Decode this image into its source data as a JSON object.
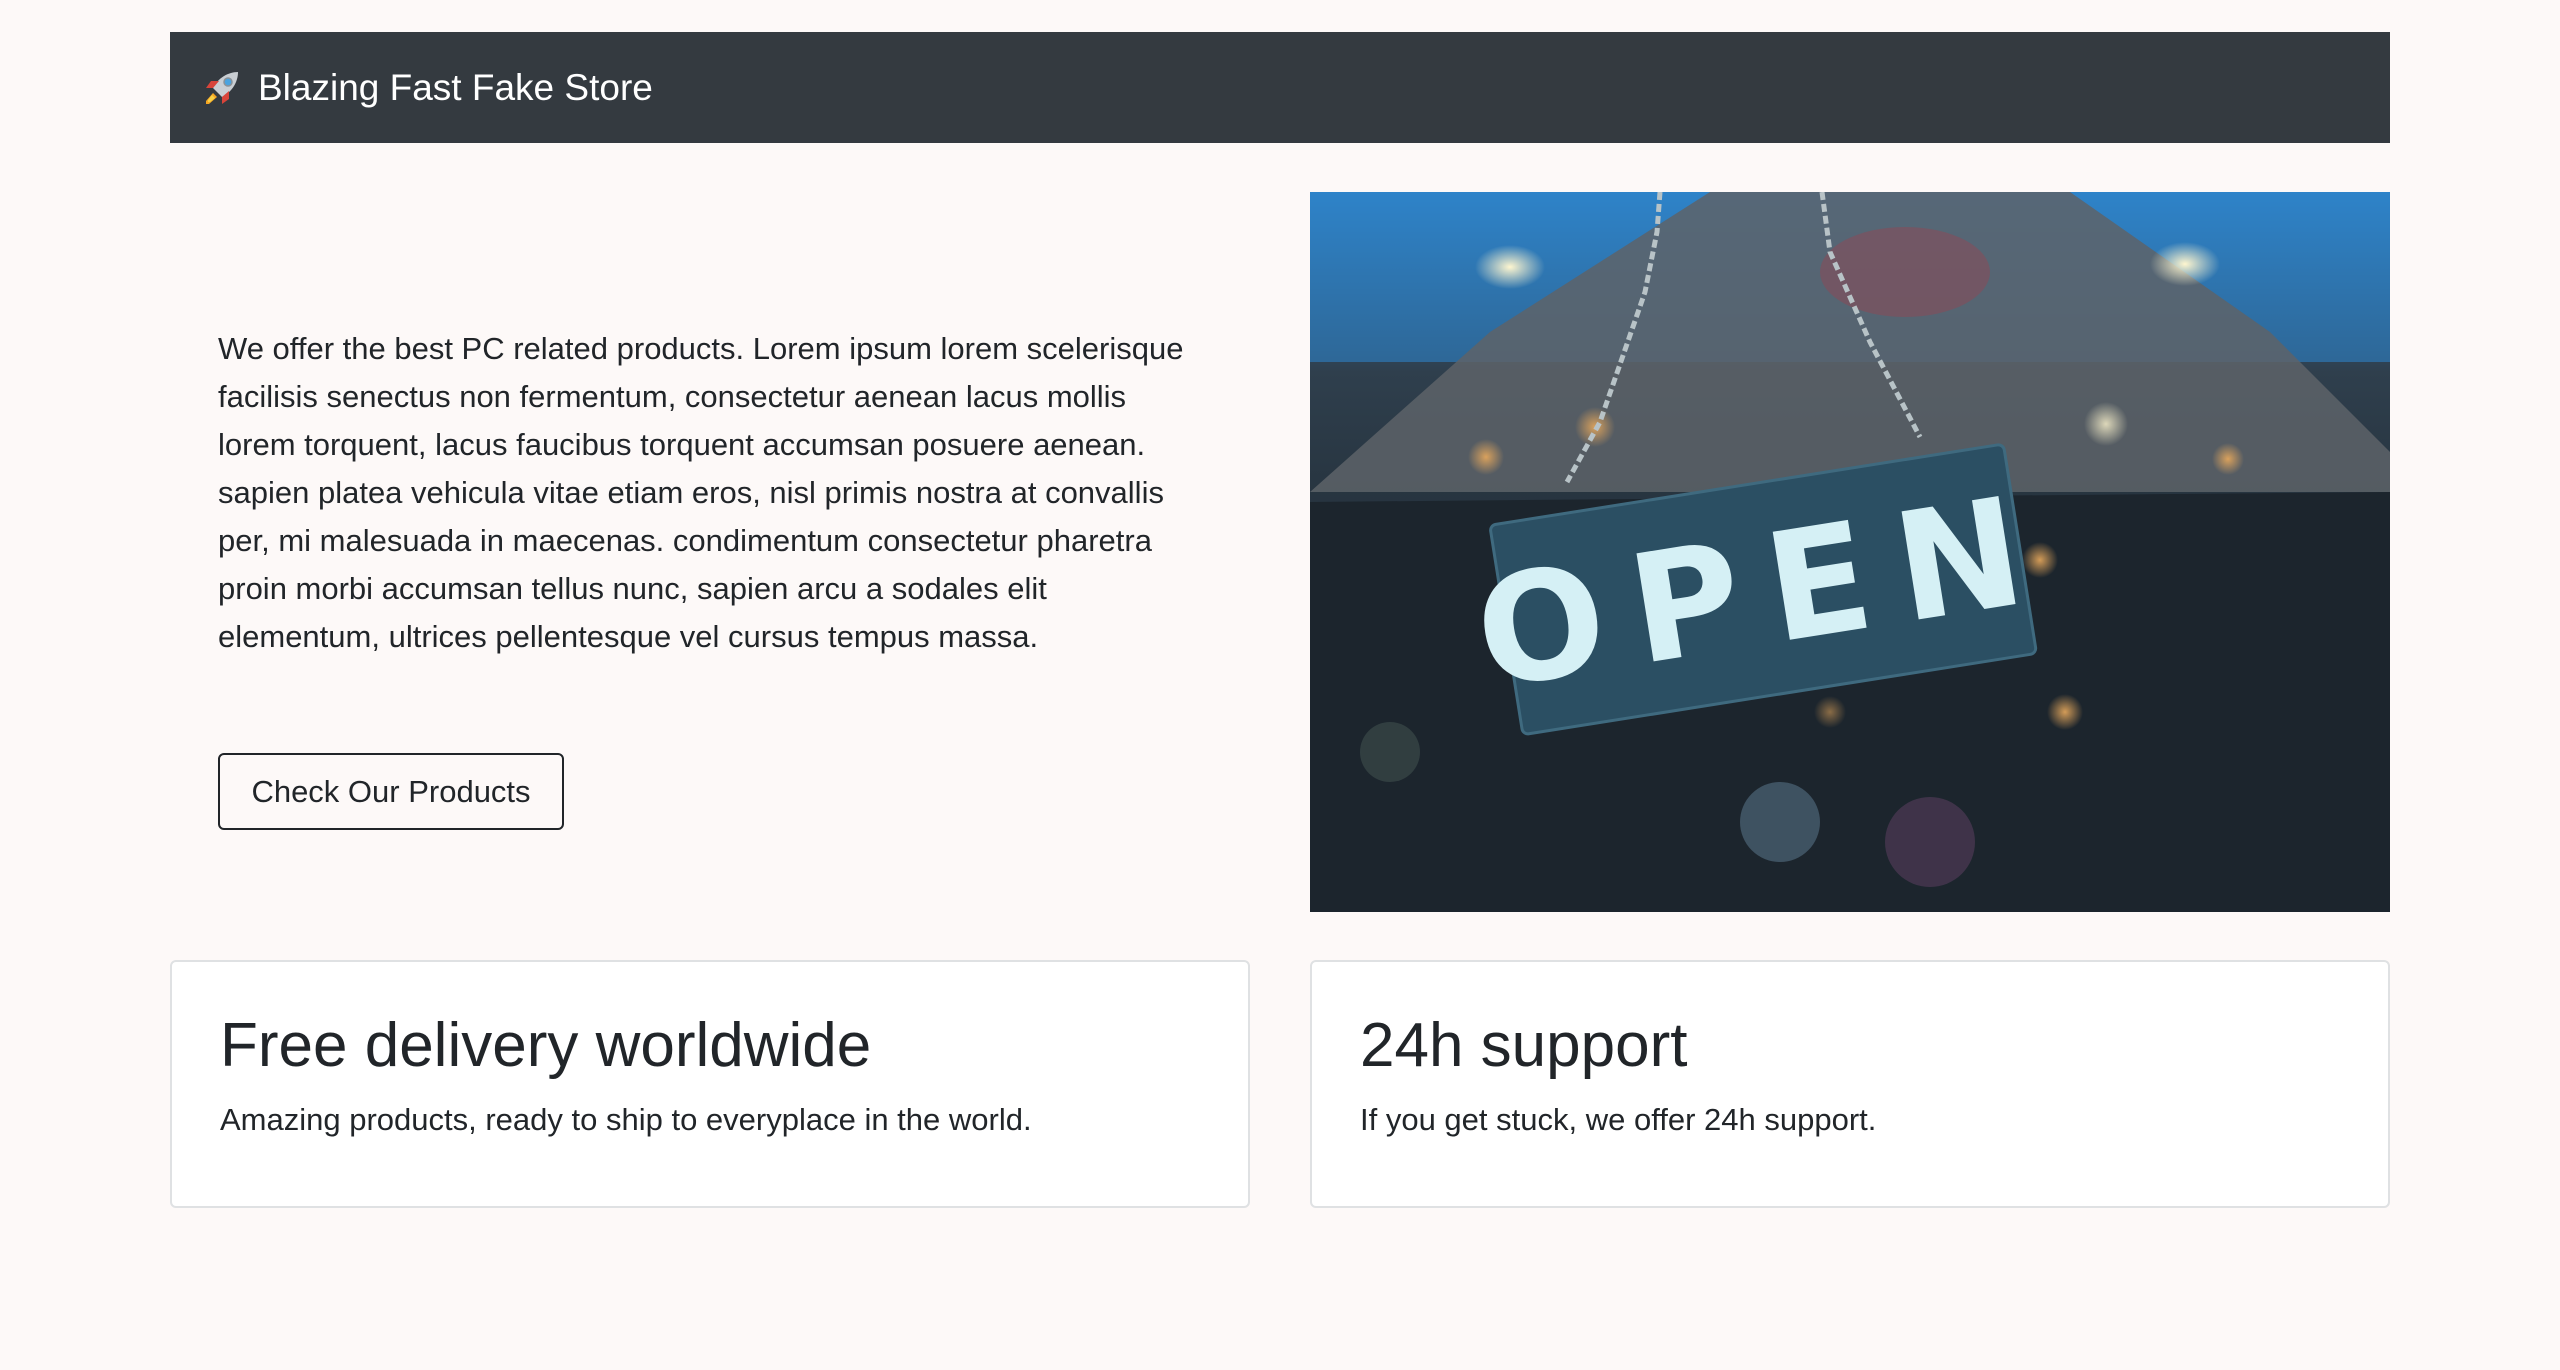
{
  "navbar": {
    "brand_icon": "rocket-icon",
    "brand_title": "Blazing Fast Fake Store",
    "background_color": "#343a40"
  },
  "hero": {
    "description": "We offer the best PC related products. Lorem ipsum lorem scelerisque facilisis senectus non fermentum, consectetur aenean lacus mollis lorem torquent, lacus faucibus torquent accumsan posuere aenean. sapien platea vehicula vitae etiam eros, nisl primis nostra at convallis per, mi malesuada in maecenas. condimentum consectetur pharetra proin morbi accumsan tellus nunc, sapien arcu a sodales elit elementum, ultrices pellentesque vel cursus tempus massa.",
    "button_label": "Check Our Products",
    "image_sign_text": "OPEN"
  },
  "features": [
    {
      "title": "Free delivery worldwide",
      "text": "Amazing products, ready to ship to everyplace in the world."
    },
    {
      "title": "24h support",
      "text": "If you get stuck, we offer 24h support."
    }
  ]
}
